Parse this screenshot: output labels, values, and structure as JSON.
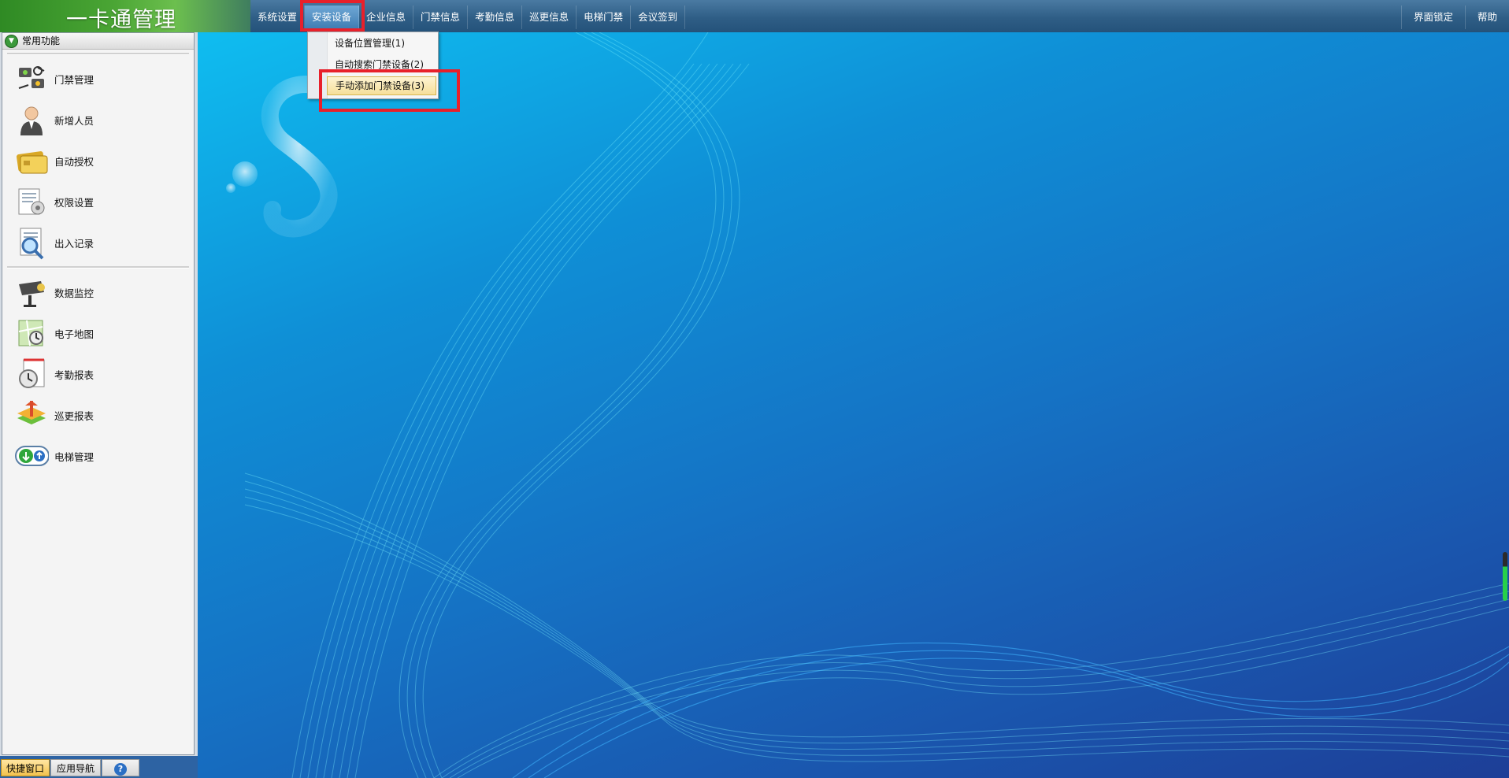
{
  "app": {
    "title": "一卡通管理"
  },
  "menu": [
    {
      "label": "系统设置",
      "active": false
    },
    {
      "label": "安装设备",
      "active": true
    },
    {
      "label": "企业信息",
      "active": false
    },
    {
      "label": "门禁信息",
      "active": false
    },
    {
      "label": "考勤信息",
      "active": false
    },
    {
      "label": "巡更信息",
      "active": false
    },
    {
      "label": "电梯门禁",
      "active": false
    },
    {
      "label": "会议签到",
      "active": false
    }
  ],
  "right_menu": {
    "lock": "界面锁定",
    "help": "帮助"
  },
  "dropdown": {
    "items": [
      {
        "label": "设备位置管理(1)"
      },
      {
        "label": "自动搜索门禁设备(2)"
      },
      {
        "label": "手动添加门禁设备(3)",
        "highlighted": true
      }
    ]
  },
  "sidebar": {
    "header": "常用功能",
    "items": [
      {
        "label": "门禁管理",
        "icon": "access-control-icon"
      },
      {
        "label": "新增人员",
        "icon": "person-icon"
      },
      {
        "label": "自动授权",
        "icon": "card-icon"
      },
      {
        "label": "权限设置",
        "icon": "permission-icon"
      },
      {
        "label": "出入记录",
        "icon": "search-document-icon"
      },
      {
        "label": "数据监控",
        "icon": "camera-icon"
      },
      {
        "label": "电子地图",
        "icon": "map-icon"
      },
      {
        "label": "考勤报表",
        "icon": "clock-report-icon"
      },
      {
        "label": "巡更报表",
        "icon": "patrol-icon"
      },
      {
        "label": "电梯管理",
        "icon": "elevator-icon"
      }
    ]
  },
  "bottom_tabs": {
    "quick": "快捷窗口",
    "nav": "应用导航",
    "help": "?"
  },
  "colors": {
    "highlight_red": "#e8202a",
    "menu_bar": "#2f5e86",
    "brand_green": "#4aa534"
  }
}
